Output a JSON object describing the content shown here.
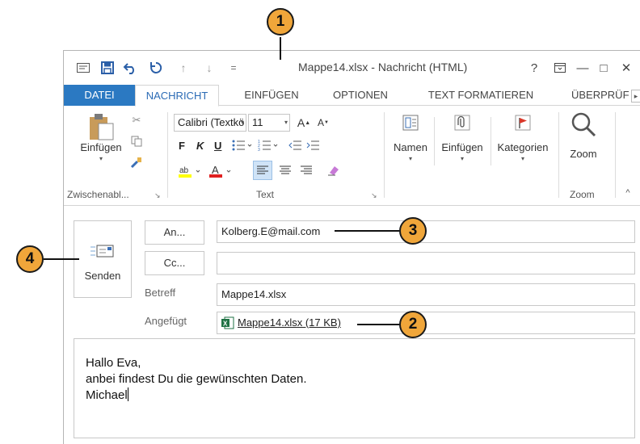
{
  "window": {
    "title": "Mappe14.xlsx - Nachricht (HTML)",
    "help": "?",
    "minimize": "—",
    "restore": "□",
    "close": "✕"
  },
  "tabs": [
    {
      "label": "DATEI"
    },
    {
      "label": "NACHRICHT"
    },
    {
      "label": "EINFÜGEN"
    },
    {
      "label": "OPTIONEN"
    },
    {
      "label": "TEXT FORMATIEREN"
    },
    {
      "label": "ÜBERPRÜF"
    }
  ],
  "ribbon": {
    "clipboard": {
      "paste_label": "Einfügen",
      "group_label": "Zwischenabl..."
    },
    "text": {
      "font_name": "Calibri (Textkö",
      "font_size": "11",
      "bold": "F",
      "italic": "K",
      "underline": "U",
      "group_label": "Text"
    },
    "names": {
      "label": "Namen"
    },
    "include": {
      "label": "Einfügen"
    },
    "tags": {
      "label": "Kategorien"
    },
    "zoom": {
      "label": "Zoom",
      "group_label": "Zoom"
    }
  },
  "message": {
    "send_label": "Senden",
    "to_button": "An...",
    "cc_button": "Cc...",
    "to_value": "Kolberg.E@mail.com",
    "cc_value": "",
    "subject_label": "Betreff",
    "subject_value": "Mappe14.xlsx",
    "attached_label": "Angefügt",
    "attachment": "Mappe14.xlsx (17 KB)",
    "body_lines": [
      "Hallo Eva,",
      "anbei findest Du die gewünschten Daten.",
      "Michael"
    ]
  },
  "callouts": [
    "1",
    "2",
    "3",
    "4"
  ],
  "colors": {
    "file_tab": "#2b79c2",
    "active_tab_text": "#2b6bb5",
    "callout_fill": "#f0a63a",
    "excel_green": "#1f7244",
    "flag_red": "#d9382a"
  }
}
